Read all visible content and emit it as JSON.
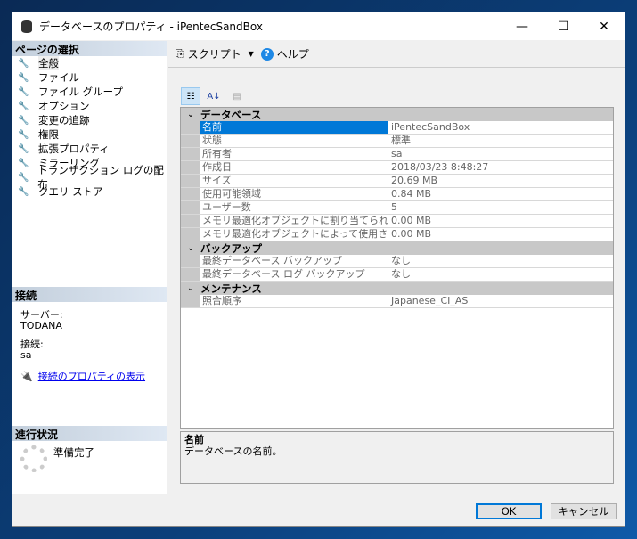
{
  "window": {
    "title": "データベースのプロパティ - iPentecSandBox",
    "minimize": "—",
    "maximize": "☐",
    "close": "✕"
  },
  "left": {
    "page_select_header": "ページの選択",
    "pages": [
      "全般",
      "ファイル",
      "ファイル グループ",
      "オプション",
      "変更の追跡",
      "権限",
      "拡張プロパティ",
      "ミラーリング",
      "トランザクション ログの配布",
      "クエリ ストア"
    ],
    "connection_header": "接続",
    "server_label": "サーバー:",
    "server_value": "TODANA",
    "conn_label": "接続:",
    "conn_value": "sa",
    "conn_link": "接続のプロパティの表示",
    "progress_header": "進行状況",
    "progress_status": "準備完了"
  },
  "toolbar": {
    "script": "スクリプト",
    "help": "ヘルプ"
  },
  "grid": {
    "categories": [
      {
        "name": "データベース",
        "rows": [
          [
            "名前",
            "iPentecSandBox"
          ],
          [
            "状態",
            "標準"
          ],
          [
            "所有者",
            "sa"
          ],
          [
            "作成日",
            "2018/03/23 8:48:27"
          ],
          [
            "サイズ",
            "20.69 MB"
          ],
          [
            "使用可能領域",
            "0.84 MB"
          ],
          [
            "ユーザー数",
            "5"
          ],
          [
            "メモリ最適化オブジェクトに割り当てられたメモリ",
            "0.00 MB"
          ],
          [
            "メモリ最適化オブジェクトによって使用されるメモリ",
            "0.00 MB"
          ]
        ]
      },
      {
        "name": "バックアップ",
        "rows": [
          [
            "最終データベース バックアップ",
            "なし"
          ],
          [
            "最終データベース ログ バックアップ",
            "なし"
          ]
        ]
      },
      {
        "name": "メンテナンス",
        "rows": [
          [
            "照合順序",
            "Japanese_CI_AS"
          ]
        ]
      }
    ],
    "selected": "名前"
  },
  "description": {
    "title": "名前",
    "text": "データベースの名前。"
  },
  "buttons": {
    "ok": "OK",
    "cancel": "キャンセル"
  },
  "colors": {
    "selection": "#0078d7",
    "link": "#0000ee"
  }
}
